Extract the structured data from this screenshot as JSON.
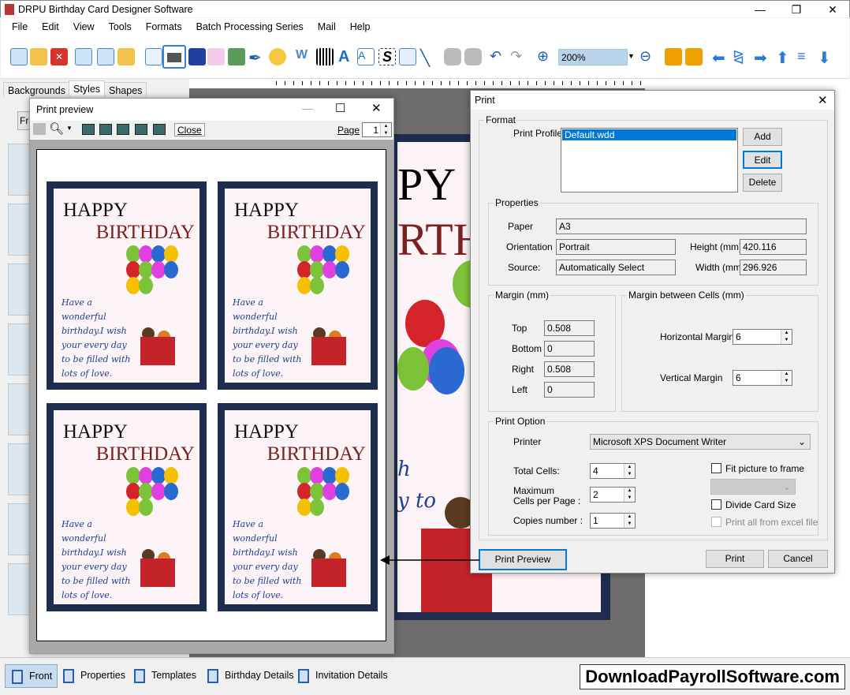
{
  "app": {
    "title": "DRPU Birthday Card Designer Software"
  },
  "menu": [
    "File",
    "Edit",
    "View",
    "Tools",
    "Formats",
    "Batch Processing Series",
    "Mail",
    "Help"
  ],
  "toolbar": {
    "zoom": "200%"
  },
  "left_tabs": [
    "Backgrounds",
    "Styles",
    "Shapes"
  ],
  "left_button": "Fr",
  "bottom_tabs": [
    "Front",
    "Properties",
    "Templates",
    "Birthday Details",
    "Invitation Details"
  ],
  "watermark": "DownloadPayrollSoftware.com",
  "background_card": {
    "line1": "PY",
    "line2": "RTH",
    "line3": "h",
    "line4": "y to"
  },
  "print_preview": {
    "title": "Print preview",
    "close": "Close",
    "page_label": "Page",
    "page": "1",
    "card": {
      "title1": "HAPPY",
      "title2": "BIRTHDAY",
      "message": "Have a wonderful birthday.I wish your every day to be filled with lots of love."
    }
  },
  "print_dialog": {
    "title": "Print",
    "format": {
      "legend": "Format",
      "profile_label": "Print Profile",
      "profiles": [
        "Default.wdd"
      ],
      "add": "Add",
      "edit": "Edit",
      "delete": "Delete"
    },
    "properties": {
      "legend": "Properties",
      "paper_label": "Paper",
      "paper": "A3",
      "orientation_label": "Orientation",
      "orientation": "Portrait",
      "source_label": "Source:",
      "source": "Automatically Select",
      "height_label": "Height (mm)",
      "height": "420.116",
      "width_label": "Width (mm)",
      "width": "296.926"
    },
    "margin": {
      "legend": "Margin (mm)",
      "top_label": "Top",
      "top": "0.508",
      "bottom_label": "Bottom",
      "bottom": "0",
      "right_label": "Right",
      "right": "0.508",
      "left_label": "Left",
      "left": "0"
    },
    "cell_margin": {
      "legend": "Margin between Cells (mm)",
      "h_label": "Horizontal Margin",
      "h": "6",
      "v_label": "Vertical Margin",
      "v": "6"
    },
    "print_option": {
      "legend": "Print Option",
      "printer_label": "Printer",
      "printer": "Microsoft XPS Document Writer",
      "total_label": "Total Cells:",
      "total": "4",
      "max_label1": "Maximum",
      "max_label2": "Cells per Page :",
      "max": "2",
      "copies_label": "Copies number :",
      "copies": "1",
      "fit_label": "Fit picture to frame",
      "divide_label": "Divide Card Size",
      "excel_label": "Print all from excel file"
    },
    "buttons": {
      "preview": "Print Preview",
      "print": "Print",
      "cancel": "Cancel"
    }
  }
}
